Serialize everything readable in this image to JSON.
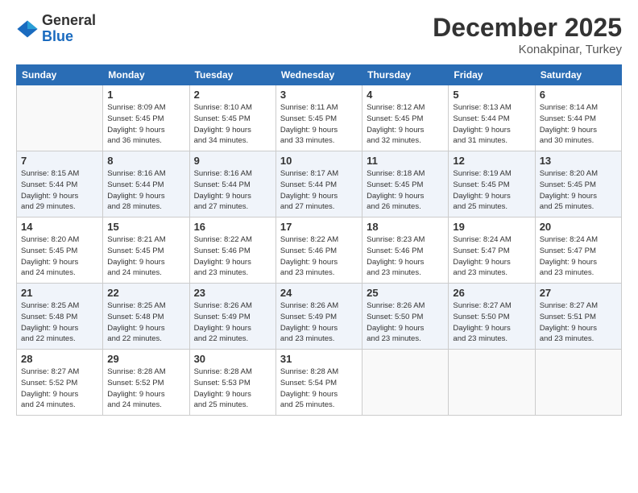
{
  "logo": {
    "general": "General",
    "blue": "Blue"
  },
  "header": {
    "month": "December 2025",
    "location": "Konakpinar, Turkey"
  },
  "weekdays": [
    "Sunday",
    "Monday",
    "Tuesday",
    "Wednesday",
    "Thursday",
    "Friday",
    "Saturday"
  ],
  "weeks": [
    [
      {
        "day": "",
        "info": ""
      },
      {
        "day": "1",
        "info": "Sunrise: 8:09 AM\nSunset: 5:45 PM\nDaylight: 9 hours\nand 36 minutes."
      },
      {
        "day": "2",
        "info": "Sunrise: 8:10 AM\nSunset: 5:45 PM\nDaylight: 9 hours\nand 34 minutes."
      },
      {
        "day": "3",
        "info": "Sunrise: 8:11 AM\nSunset: 5:45 PM\nDaylight: 9 hours\nand 33 minutes."
      },
      {
        "day": "4",
        "info": "Sunrise: 8:12 AM\nSunset: 5:45 PM\nDaylight: 9 hours\nand 32 minutes."
      },
      {
        "day": "5",
        "info": "Sunrise: 8:13 AM\nSunset: 5:44 PM\nDaylight: 9 hours\nand 31 minutes."
      },
      {
        "day": "6",
        "info": "Sunrise: 8:14 AM\nSunset: 5:44 PM\nDaylight: 9 hours\nand 30 minutes."
      }
    ],
    [
      {
        "day": "7",
        "info": ""
      },
      {
        "day": "8",
        "info": "Sunrise: 8:16 AM\nSunset: 5:44 PM\nDaylight: 9 hours\nand 28 minutes."
      },
      {
        "day": "9",
        "info": "Sunrise: 8:16 AM\nSunset: 5:44 PM\nDaylight: 9 hours\nand 27 minutes."
      },
      {
        "day": "10",
        "info": "Sunrise: 8:17 AM\nSunset: 5:44 PM\nDaylight: 9 hours\nand 27 minutes."
      },
      {
        "day": "11",
        "info": "Sunrise: 8:18 AM\nSunset: 5:45 PM\nDaylight: 9 hours\nand 26 minutes."
      },
      {
        "day": "12",
        "info": "Sunrise: 8:19 AM\nSunset: 5:45 PM\nDaylight: 9 hours\nand 25 minutes."
      },
      {
        "day": "13",
        "info": "Sunrise: 8:20 AM\nSunset: 5:45 PM\nDaylight: 9 hours\nand 25 minutes."
      }
    ],
    [
      {
        "day": "14",
        "info": ""
      },
      {
        "day": "15",
        "info": "Sunrise: 8:21 AM\nSunset: 5:45 PM\nDaylight: 9 hours\nand 24 minutes."
      },
      {
        "day": "16",
        "info": "Sunrise: 8:22 AM\nSunset: 5:46 PM\nDaylight: 9 hours\nand 23 minutes."
      },
      {
        "day": "17",
        "info": "Sunrise: 8:22 AM\nSunset: 5:46 PM\nDaylight: 9 hours\nand 23 minutes."
      },
      {
        "day": "18",
        "info": "Sunrise: 8:23 AM\nSunset: 5:46 PM\nDaylight: 9 hours\nand 23 minutes."
      },
      {
        "day": "19",
        "info": "Sunrise: 8:24 AM\nSunset: 5:47 PM\nDaylight: 9 hours\nand 23 minutes."
      },
      {
        "day": "20",
        "info": "Sunrise: 8:24 AM\nSunset: 5:47 PM\nDaylight: 9 hours\nand 23 minutes."
      }
    ],
    [
      {
        "day": "21",
        "info": ""
      },
      {
        "day": "22",
        "info": "Sunrise: 8:25 AM\nSunset: 5:48 PM\nDaylight: 9 hours\nand 22 minutes."
      },
      {
        "day": "23",
        "info": "Sunrise: 8:26 AM\nSunset: 5:49 PM\nDaylight: 9 hours\nand 22 minutes."
      },
      {
        "day": "24",
        "info": "Sunrise: 8:26 AM\nSunset: 5:49 PM\nDaylight: 9 hours\nand 23 minutes."
      },
      {
        "day": "25",
        "info": "Sunrise: 8:26 AM\nSunset: 5:50 PM\nDaylight: 9 hours\nand 23 minutes."
      },
      {
        "day": "26",
        "info": "Sunrise: 8:27 AM\nSunset: 5:50 PM\nDaylight: 9 hours\nand 23 minutes."
      },
      {
        "day": "27",
        "info": "Sunrise: 8:27 AM\nSunset: 5:51 PM\nDaylight: 9 hours\nand 23 minutes."
      }
    ],
    [
      {
        "day": "28",
        "info": "Sunrise: 8:27 AM\nSunset: 5:52 PM\nDaylight: 9 hours\nand 24 minutes."
      },
      {
        "day": "29",
        "info": "Sunrise: 8:28 AM\nSunset: 5:52 PM\nDaylight: 9 hours\nand 24 minutes."
      },
      {
        "day": "30",
        "info": "Sunrise: 8:28 AM\nSunset: 5:53 PM\nDaylight: 9 hours\nand 25 minutes."
      },
      {
        "day": "31",
        "info": "Sunrise: 8:28 AM\nSunset: 5:54 PM\nDaylight: 9 hours\nand 25 minutes."
      },
      {
        "day": "",
        "info": ""
      },
      {
        "day": "",
        "info": ""
      },
      {
        "day": "",
        "info": ""
      }
    ]
  ],
  "week7_sunday": {
    "info": "Sunrise: 8:15 AM\nSunset: 5:44 PM\nDaylight: 9 hours\nand 29 minutes."
  },
  "week14_sunday": {
    "info": "Sunrise: 8:20 AM\nSunset: 5:45 PM\nDaylight: 9 hours\nand 24 minutes."
  },
  "week21_sunday": {
    "info": "Sunrise: 8:25 AM\nSunset: 5:48 PM\nDaylight: 9 hours\nand 22 minutes."
  }
}
